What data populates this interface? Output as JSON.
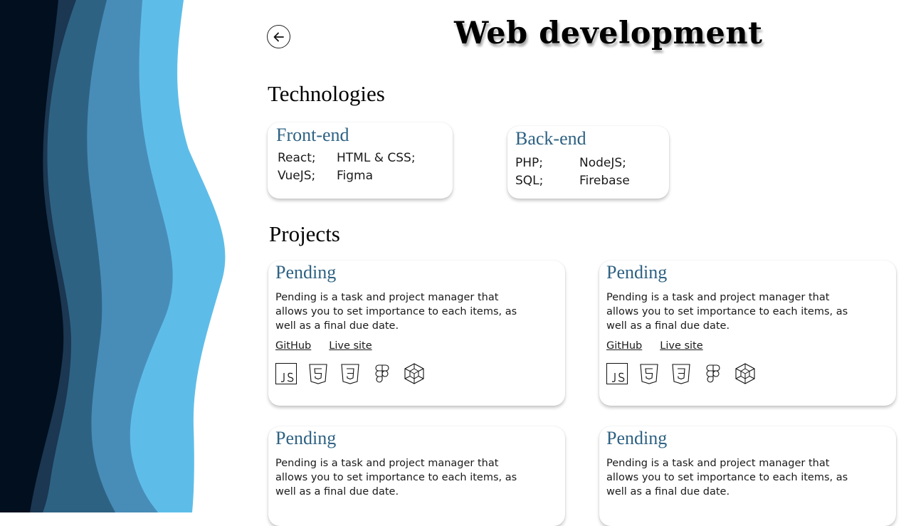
{
  "header": {
    "title": "Web development",
    "back_icon": "arrow-left-icon"
  },
  "technologies": {
    "heading": "Technologies",
    "frontend": {
      "title": "Front-end",
      "items": [
        "React;",
        "HTML & CSS;",
        "VueJS;",
        "Figma"
      ]
    },
    "backend": {
      "title": "Back-end",
      "items": [
        "PHP;",
        "NodeJS;",
        "SQL;",
        "Firebase"
      ]
    }
  },
  "projects": {
    "heading": "Projects",
    "items": [
      {
        "title": "Pending",
        "description": "Pending is a task and project manager that allows you to set importance to each items, as well as a final due date.",
        "github_label": "GitHub",
        "live_label": "Live site"
      },
      {
        "title": "Pending",
        "description": "Pending is a task and project manager that allows you to set importance to each items, as well as a final due date.",
        "github_label": "GitHub",
        "live_label": "Live site"
      },
      {
        "title": "Pending",
        "description": "Pending is a task and project manager that allows you to set importance to each items, as well as a final due date."
      },
      {
        "title": "Pending",
        "description": "Pending is a task and project manager that allows you to set importance to each items, as well as a final due date."
      }
    ],
    "tech_icons": [
      "javascript-icon",
      "html5-icon",
      "css3-icon",
      "figma-icon",
      "webpack-icon"
    ]
  },
  "colors": {
    "accent": "#2e6283",
    "wave_1": "#5ebde8",
    "wave_2": "#488db8",
    "wave_3": "#2e6283",
    "wave_4": "#1b3751",
    "wave_5": "#010f1e"
  }
}
